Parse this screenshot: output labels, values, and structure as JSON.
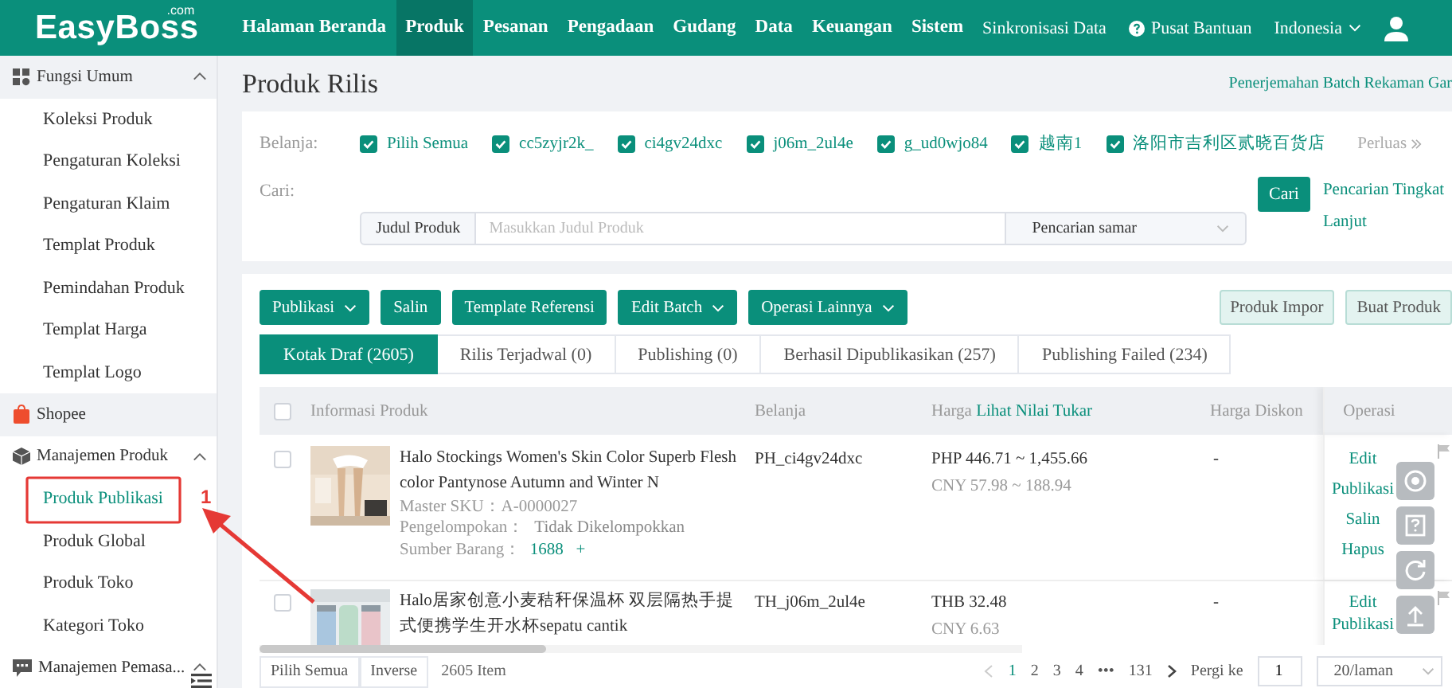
{
  "topbar": {
    "logo": "EasyBoss",
    "logo_suffix": ".com",
    "nav": [
      {
        "label": "Halaman Beranda",
        "selected": false
      },
      {
        "label": "Produk",
        "selected": true
      },
      {
        "label": "Pesanan",
        "selected": false
      },
      {
        "label": "Pengadaan",
        "selected": false
      },
      {
        "label": "Gudang",
        "selected": false
      },
      {
        "label": "Data",
        "selected": false
      },
      {
        "label": "Keuangan",
        "selected": false
      },
      {
        "label": "Sistem",
        "selected": false
      }
    ],
    "sync": "Sinkronisasi Data",
    "help": "Pusat Bantuan",
    "language": "Indonesia"
  },
  "sidebar": {
    "groups": [
      {
        "label": "Fungsi Umum",
        "highlighted": true,
        "expanded": true,
        "children": [
          {
            "label": "Koleksi Produk",
            "selected": false
          },
          {
            "label": "Pengaturan Koleksi",
            "selected": false
          },
          {
            "label": "Pengaturan Klaim",
            "selected": false
          },
          {
            "label": "Templat Produk",
            "selected": false
          },
          {
            "label": "Pemindahan Produk",
            "selected": false
          },
          {
            "label": "Templat Harga",
            "selected": false
          },
          {
            "label": "Templat Logo",
            "selected": false
          }
        ]
      },
      {
        "label": "Shopee",
        "highlighted": true
      },
      {
        "label": "Manajemen Produk",
        "highlighted": false,
        "expanded": true,
        "children": [
          {
            "label": "Produk Publikasi",
            "selected": true
          },
          {
            "label": "Produk Global",
            "selected": false
          },
          {
            "label": "Produk Toko",
            "selected": false
          },
          {
            "label": "Kategori Toko",
            "selected": false
          }
        ]
      },
      {
        "label": "Manajemen Pemasa...",
        "highlighted": false,
        "expanded": true
      }
    ]
  },
  "page": {
    "title": "Produk Rilis",
    "batch_link": "Penerjemahan Batch Rekaman Gar"
  },
  "filter": {
    "shop_label": "Belanja:",
    "shops": [
      {
        "label": "Pilih Semua",
        "checked": true
      },
      {
        "label": "cc5zyjr2k_",
        "checked": true
      },
      {
        "label": "ci4gv24dxc",
        "checked": true
      },
      {
        "label": "j06m_2ul4e",
        "checked": true
      },
      {
        "label": "g_ud0wjo84",
        "checked": true
      },
      {
        "label": "越南1",
        "checked": true
      },
      {
        "label": "洛阳市吉利区贰晓百货店",
        "checked": true
      }
    ],
    "expand": "Perluas",
    "search_label": "Cari:",
    "search_field": {
      "label": "Judul Produk",
      "placeholder": "Masukkan Judul Produk"
    },
    "match_mode": "Pencarian samar",
    "search_button": "Cari",
    "advanced_link": "Pencarian Tingkat Lanjut"
  },
  "toolbar": {
    "actions": [
      {
        "label": "Publikasi",
        "dropdown": true
      },
      {
        "label": "Salin",
        "dropdown": false
      },
      {
        "label": "Template Referensi",
        "dropdown": false
      },
      {
        "label": "Edit Batch",
        "dropdown": true
      },
      {
        "label": "Operasi Lainnya",
        "dropdown": true
      }
    ],
    "right_actions": [
      "Produk Impor",
      "Buat Produk"
    ]
  },
  "tabs": [
    {
      "label": "Kotak Draf (2605)",
      "selected": true
    },
    {
      "label": "Rilis Terjadwal (0)",
      "selected": false
    },
    {
      "label": "Publishing (0)",
      "selected": false
    },
    {
      "label": "Berhasil Dipublikasikan (257)",
      "selected": false
    },
    {
      "label": "Publishing Failed (234)",
      "selected": false
    }
  ],
  "table": {
    "header_checked": false,
    "columns": [
      {
        "label": "Informasi Produk"
      },
      {
        "label": "Belanja"
      },
      {
        "label": "Harga",
        "link": "Lihat Nilai Tukar"
      },
      {
        "label": "Harga Diskon"
      },
      {
        "label": "Operasi"
      }
    ],
    "rows": [
      {
        "checked": false,
        "title": "Halo Stockings Women's Skin Color Superb Fleshcolor Pantynose Autumn and Winter N",
        "sku_label": "Master SKU：",
        "sku": "A-0000027",
        "group_label": "Pengelompokan：",
        "group": "Tidak Dikelompokkan",
        "source_label": "Sumber Barang：",
        "source": "1688",
        "add": "+",
        "shop": "PH_ci4gv24dxc",
        "price": "PHP 446.71 ~ 1,455.66",
        "price_cny": "CNY 57.98 ~ 188.94",
        "discount": "-",
        "operations": [
          "Edit",
          "Publikasi",
          "Salin",
          "Hapus"
        ]
      },
      {
        "checked": false,
        "title": "Halo居家创意小麦秸秆保温杯 双层隔热手提式便携学生开水杯sepatu cantik",
        "shop": "TH_j06m_2ul4e",
        "price": "THB 32.48",
        "price_cny": "CNY 6.63",
        "discount": "-",
        "operations": [
          "Edit",
          "Publikasi"
        ]
      }
    ]
  },
  "footer": {
    "select_all": "Pilih Semua",
    "inverse": "Inverse",
    "count": "2605 Item",
    "pages": [
      {
        "label": "1",
        "selected": true
      },
      {
        "label": "2",
        "selected": false
      },
      {
        "label": "3",
        "selected": false
      },
      {
        "label": "4",
        "selected": false
      },
      {
        "label": "•••",
        "selected": false
      },
      {
        "label": "131",
        "selected": false
      }
    ],
    "goto_label": "Pergi ke",
    "goto_value": "1",
    "page_size": "20/laman"
  },
  "annotation": {
    "number": "1"
  }
}
